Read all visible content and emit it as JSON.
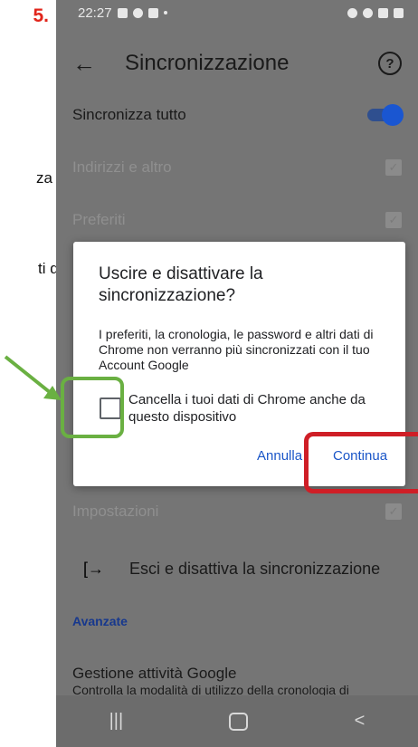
{
  "doc": {
    "step_number": "5.",
    "fragment_line_1": "za",
    "fragment_line_2": "ti di"
  },
  "status_bar": {
    "time": "22:27"
  },
  "app_bar": {
    "title": "Sincronizzazione",
    "back_icon": "arrow-left-icon",
    "help_icon": "help-circle-icon"
  },
  "settings": {
    "sync_all": {
      "label": "Sincronizza tutto",
      "enabled": true
    },
    "items": [
      {
        "label": "Indirizzi e altro",
        "checked": true
      },
      {
        "label": "Preferiti",
        "checked": true
      },
      {
        "label": "Impostazioni",
        "checked": true
      }
    ],
    "signout_label": "Esci e disattiva la sincronizzazione",
    "advanced_header": "Avanzate",
    "activity_title": "Gestione attività Google",
    "activity_sub": "Controlla la modalità di utilizzo della cronologia di"
  },
  "dialog": {
    "title": "Uscire e disattivare la sincronizzazione?",
    "body": "I preferiti, la cronologia, le password e altri dati di Chrome non verranno più sincronizzati con il tuo Account Google",
    "checkbox_label": "Cancella i tuoi dati di Chrome anche da questo dispositivo",
    "checkbox_checked": false,
    "cancel_label": "Annulla",
    "continue_label": "Continua"
  },
  "colors": {
    "accent": "#1a56c8",
    "highlight_green": "#6ab042",
    "highlight_red": "#cf1e26",
    "step_red": "#e1251b"
  }
}
